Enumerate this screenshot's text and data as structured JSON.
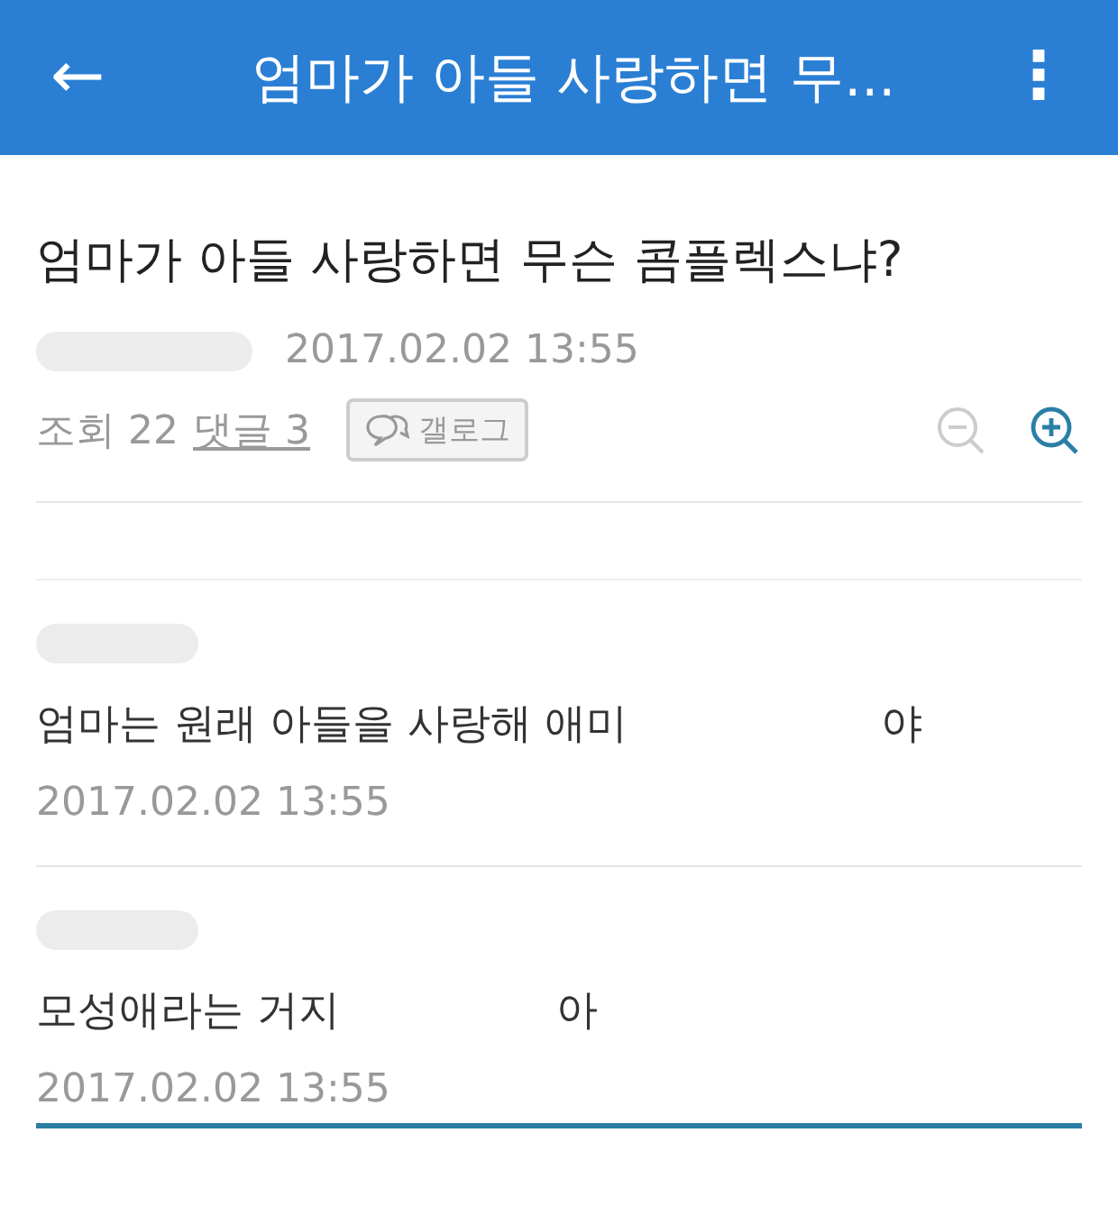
{
  "app_bar": {
    "back": "←",
    "title": "엄마가 아들 사랑하면 무...",
    "menu": "⋮"
  },
  "post": {
    "title": "엄마가 아들 사랑하면 무슨 콤플렉스냐?",
    "date": "2017.02.02 13:55",
    "views_label": "조회 22",
    "comments_link": "댓글 3",
    "gallog_button": "갤로그"
  },
  "comments": [
    {
      "text": "엄마는 원래 아들을 사랑해 애미",
      "tail": "야",
      "date": "2017.02.02 13:55"
    },
    {
      "text": "모성애라는 거지",
      "tail": "아",
      "date": "2017.02.02 13:55"
    }
  ]
}
